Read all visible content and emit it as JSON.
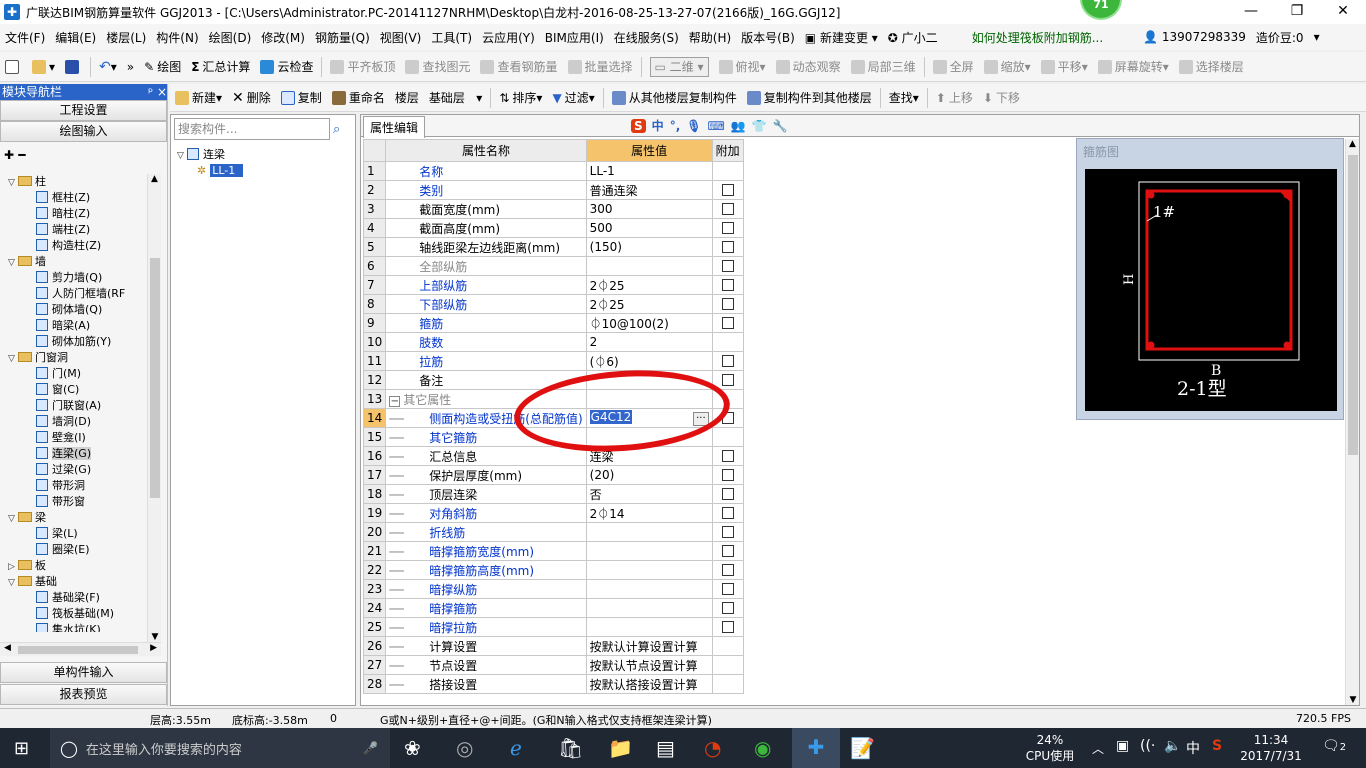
{
  "window": {
    "title": "广联达BIM钢筋算量软件 GGJ2013 - [C:\\Users\\Administrator.PC-20141127NRHM\\Desktop\\白龙村-2016-08-25-13-27-07(2166版)_16G.GGJ12]",
    "badge": "71"
  },
  "menu": {
    "items": [
      "文件(F)",
      "编辑(E)",
      "楼层(L)",
      "构件(N)",
      "绘图(D)",
      "修改(M)",
      "钢筋量(Q)",
      "视图(V)",
      "工具(T)",
      "云应用(Y)",
      "BIM应用(I)",
      "在线服务(S)",
      "帮助(H)",
      "版本号(B)"
    ],
    "new_change": "新建变更",
    "guangxiaoer": "广小二",
    "hint_link": "如何处理筏板附加钢筋...",
    "phone": "13907298339",
    "cost_beans": "造价豆:0"
  },
  "toolbar1": {
    "draw": "绘图",
    "sum": "汇总计算",
    "cloud_check": "云检查",
    "flat_top": "平齐板顶",
    "find_elem": "查找图元",
    "view_rebar": "查看钢筋量",
    "batch_select": "批量选择",
    "view_mode": "二维",
    "top_view": "俯视",
    "dynamic": "动态观察",
    "local3d": "局部三维",
    "fullscreen": "全屏",
    "zoom": "缩放",
    "pan": "平移",
    "rotate": "屏幕旋转",
    "select_floor": "选择楼层"
  },
  "toolbar2": {
    "new": "新建",
    "delete": "删除",
    "copy": "复制",
    "rename": "重命名",
    "floor_label": "楼层",
    "floor_value": "基础层",
    "sort": "排序",
    "filter": "过滤",
    "copy_from": "从其他楼层复制构件",
    "copy_to": "复制构件到其他楼层",
    "find": "查找",
    "move_up": "上移",
    "move_down": "下移"
  },
  "leftpanel": {
    "header": "模块导航栏",
    "pin": "ᵖ ×",
    "project_settings": "工程设置",
    "draw_input": "绘图输入",
    "single_input": "单构件输入",
    "report_preview": "报表预览",
    "tree": [
      {
        "label": "柱",
        "level": 0,
        "folder": true
      },
      {
        "label": "框柱(Z)",
        "level": 1
      },
      {
        "label": "暗柱(Z)",
        "level": 1
      },
      {
        "label": "端柱(Z)",
        "level": 1
      },
      {
        "label": "构造柱(Z)",
        "level": 1
      },
      {
        "label": "墙",
        "level": 0,
        "folder": true
      },
      {
        "label": "剪力墙(Q)",
        "level": 1
      },
      {
        "label": "人防门框墙(RF",
        "level": 1
      },
      {
        "label": "砌体墙(Q)",
        "level": 1
      },
      {
        "label": "暗梁(A)",
        "level": 1
      },
      {
        "label": "砌体加筋(Y)",
        "level": 1
      },
      {
        "label": "门窗洞",
        "level": 0,
        "folder": true
      },
      {
        "label": "门(M)",
        "level": 1
      },
      {
        "label": "窗(C)",
        "level": 1
      },
      {
        "label": "门联窗(A)",
        "level": 1
      },
      {
        "label": "墙洞(D)",
        "level": 1
      },
      {
        "label": "壁龛(I)",
        "level": 1
      },
      {
        "label": "连梁(G)",
        "level": 1,
        "selected": true
      },
      {
        "label": "过梁(G)",
        "level": 1
      },
      {
        "label": "带形洞",
        "level": 1
      },
      {
        "label": "带形窗",
        "level": 1
      },
      {
        "label": "梁",
        "level": 0,
        "folder": true
      },
      {
        "label": "梁(L)",
        "level": 1
      },
      {
        "label": "圈梁(E)",
        "level": 1
      },
      {
        "label": "板",
        "level": 0,
        "folder": true,
        "collapsed": true
      },
      {
        "label": "基础",
        "level": 0,
        "folder": true
      },
      {
        "label": "基础梁(F)",
        "level": 1
      },
      {
        "label": "筏板基础(M)",
        "level": 1
      },
      {
        "label": "集水坑(K)",
        "level": 1
      }
    ]
  },
  "midpanel": {
    "search_placeholder": "搜索构件...",
    "root": "连梁",
    "child": "LL-1"
  },
  "prop": {
    "tab": "属性编辑",
    "headers": [
      "属性名称",
      "属性值",
      "附加"
    ],
    "rows": [
      {
        "n": "1",
        "name": "名称",
        "val": "LL-1",
        "cls": "blue",
        "cb": false,
        "indent": 0
      },
      {
        "n": "2",
        "name": "类别",
        "val": "普通连梁",
        "cls": "blue",
        "cb": true,
        "indent": 0
      },
      {
        "n": "3",
        "name": "截面宽度(mm)",
        "val": "300",
        "cls": "",
        "cb": true,
        "indent": 0
      },
      {
        "n": "4",
        "name": "截面高度(mm)",
        "val": "500",
        "cls": "",
        "cb": true,
        "indent": 0
      },
      {
        "n": "5",
        "name": "轴线距梁左边线距离(mm)",
        "val": "(150)",
        "cls": "",
        "cb": true,
        "indent": 0
      },
      {
        "n": "6",
        "name": "全部纵筋",
        "val": "",
        "cls": "gray",
        "cb": true,
        "indent": 0
      },
      {
        "n": "7",
        "name": "上部纵筋",
        "val": "2⏀25",
        "cls": "blue",
        "cb": true,
        "indent": 0
      },
      {
        "n": "8",
        "name": "下部纵筋",
        "val": "2⏀25",
        "cls": "blue",
        "cb": true,
        "indent": 0
      },
      {
        "n": "9",
        "name": "箍筋",
        "val": "⏀10@100(2)",
        "cls": "blue",
        "cb": true,
        "indent": 0
      },
      {
        "n": "10",
        "name": "肢数",
        "val": "2",
        "cls": "blue",
        "cb": false,
        "indent": 0
      },
      {
        "n": "11",
        "name": "拉筋",
        "val": "(⏀6)",
        "cls": "blue",
        "cb": true,
        "indent": 0
      },
      {
        "n": "12",
        "name": "备注",
        "val": "",
        "cls": "",
        "cb": true,
        "indent": 0
      },
      {
        "n": "13",
        "name": "其它属性",
        "val": "",
        "cls": "gray",
        "cb": false,
        "indent": 0,
        "group": true
      },
      {
        "n": "14",
        "name": "侧面构造或受扭筋(总配筋值)",
        "val": "G4C12",
        "cls": "blue",
        "cb": true,
        "indent": 1,
        "selected": true
      },
      {
        "n": "15",
        "name": "其它箍筋",
        "val": "",
        "cls": "blue",
        "cb": false,
        "indent": 1
      },
      {
        "n": "16",
        "name": "汇总信息",
        "val": "连梁",
        "cls": "",
        "cb": true,
        "indent": 1
      },
      {
        "n": "17",
        "name": "保护层厚度(mm)",
        "val": "(20)",
        "cls": "",
        "cb": true,
        "indent": 1
      },
      {
        "n": "18",
        "name": "顶层连梁",
        "val": "否",
        "cls": "",
        "cb": true,
        "indent": 1
      },
      {
        "n": "19",
        "name": "对角斜筋",
        "val": "2⏀14",
        "cls": "blue",
        "cb": true,
        "indent": 1
      },
      {
        "n": "20",
        "name": "折线筋",
        "val": "",
        "cls": "blue",
        "cb": true,
        "indent": 1
      },
      {
        "n": "21",
        "name": "暗撑箍筋宽度(mm)",
        "val": "",
        "cls": "blue",
        "cb": true,
        "indent": 1
      },
      {
        "n": "22",
        "name": "暗撑箍筋高度(mm)",
        "val": "",
        "cls": "blue",
        "cb": true,
        "indent": 1
      },
      {
        "n": "23",
        "name": "暗撑纵筋",
        "val": "",
        "cls": "blue",
        "cb": true,
        "indent": 1
      },
      {
        "n": "24",
        "name": "暗撑箍筋",
        "val": "",
        "cls": "blue",
        "cb": true,
        "indent": 1
      },
      {
        "n": "25",
        "name": "暗撑拉筋",
        "val": "",
        "cls": "blue",
        "cb": true,
        "indent": 1
      },
      {
        "n": "26",
        "name": "计算设置",
        "val": "按默认计算设置计算",
        "cls": "",
        "cb": false,
        "indent": 1
      },
      {
        "n": "27",
        "name": "节点设置",
        "val": "按默认节点设置计算",
        "cls": "",
        "cb": false,
        "indent": 1
      },
      {
        "n": "28",
        "name": "搭接设置",
        "val": "按默认搭接设置计算",
        "cls": "",
        "cb": false,
        "indent": 1
      }
    ]
  },
  "stirrup": {
    "caption": "箍筋图",
    "label_1": "1#",
    "label_h": "H",
    "label_b": "B",
    "type": "2-1型"
  },
  "status": {
    "floor_height": "层高:3.55m",
    "bottom_elev": "底标高:-3.58m",
    "zero": "0",
    "hint": "G或N+级别+直径+@+间距。(G和N输入格式仅支持框架连梁计算)",
    "fps": "720.5 FPS"
  },
  "taskbar": {
    "search_placeholder": "在这里输入你要搜索的内容",
    "cpu_pct": "24%",
    "cpu_label": "CPU使用",
    "ime": "中",
    "time": "11:34",
    "date": "2017/7/31",
    "notif": "2"
  },
  "colors": {
    "accent": "#2a64c8",
    "highlight": "#f5c36b",
    "annotation": "#e01010"
  }
}
